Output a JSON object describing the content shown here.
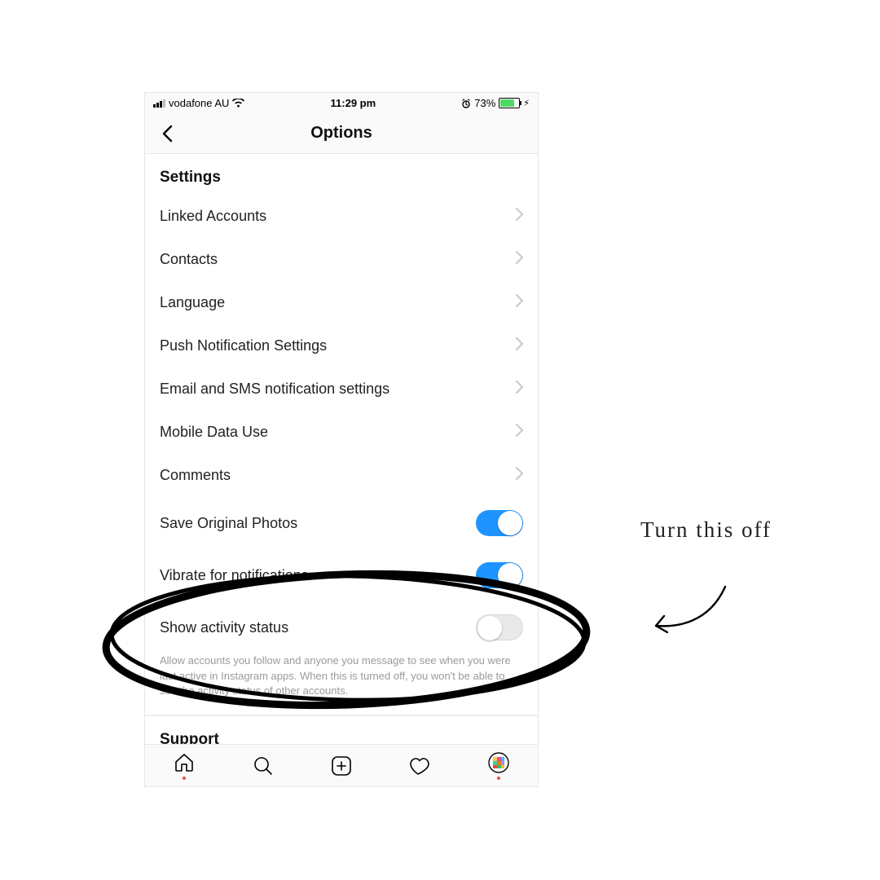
{
  "status": {
    "carrier": "vodafone AU",
    "time": "11:29 pm",
    "battery_pct": "73%"
  },
  "nav": {
    "title": "Options"
  },
  "settings": {
    "header": "Settings",
    "rows": {
      "linked_accounts": "Linked Accounts",
      "contacts": "Contacts",
      "language": "Language",
      "push_notif": "Push Notification Settings",
      "email_sms": "Email and SMS notification settings",
      "mobile_data": "Mobile Data Use",
      "comments": "Comments",
      "save_photos": "Save Original Photos",
      "vibrate": "Vibrate for notifications",
      "activity": "Show activity status"
    },
    "activity_desc": "Allow accounts you follow and anyone you message to see when you were last active in Instagram apps. When this is turned off, you won't be able to see the activity status of other accounts."
  },
  "support_header": "Support",
  "annotation": {
    "text": "Turn this off"
  },
  "colors": {
    "toggle_on": "#1f94ff",
    "battery_fill": "#4cd964"
  }
}
